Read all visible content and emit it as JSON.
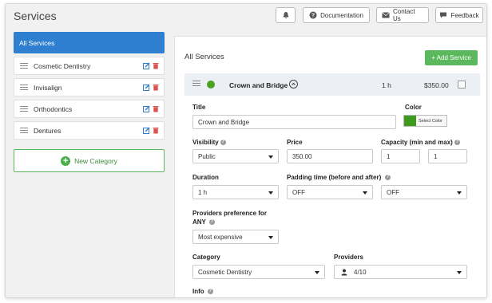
{
  "header": {
    "title": "Services",
    "buttons": {
      "documentation": "Documentation",
      "contact": "Contact Us",
      "feedback": "Feedback"
    }
  },
  "sidebar": {
    "all_label": "All Services",
    "items": [
      {
        "label": "Cosmetic Dentistry"
      },
      {
        "label": "Invisalign"
      },
      {
        "label": "Orthodontics"
      },
      {
        "label": "Dentures"
      }
    ],
    "new_category": "New Category"
  },
  "main": {
    "title": "All Services",
    "add_button": "+ Add Service",
    "service": {
      "name": "Crown and Bridge",
      "duration": "1 h",
      "price": "$350.00",
      "color": "#3e9a1c"
    },
    "form": {
      "title_label": "Title",
      "title_value": "Crown and Bridge",
      "color_label": "Color",
      "color_button": "Select Color",
      "visibility_label": "Visibility",
      "visibility_value": "Public",
      "price_label": "Price",
      "price_value": "350.00",
      "capacity_label": "Capacity (min and max)",
      "capacity_min": "1",
      "capacity_max": "1",
      "duration_label": "Duration",
      "duration_value": "1 h",
      "padding_label": "Padding time (before and after)",
      "padding_before": "OFF",
      "padding_after": "OFF",
      "providers_pref_label_1": "Providers preference for",
      "providers_pref_label_2": "ANY",
      "providers_pref_value": "Most expensive",
      "category_label": "Category",
      "category_value": "Cosmetic Dentistry",
      "providers_label": "Providers",
      "providers_value": "4/10",
      "info_label": "Info"
    }
  },
  "colors": {
    "primary": "#2f7fd1",
    "success": "#5cb85c",
    "delete": "#d9534f"
  }
}
